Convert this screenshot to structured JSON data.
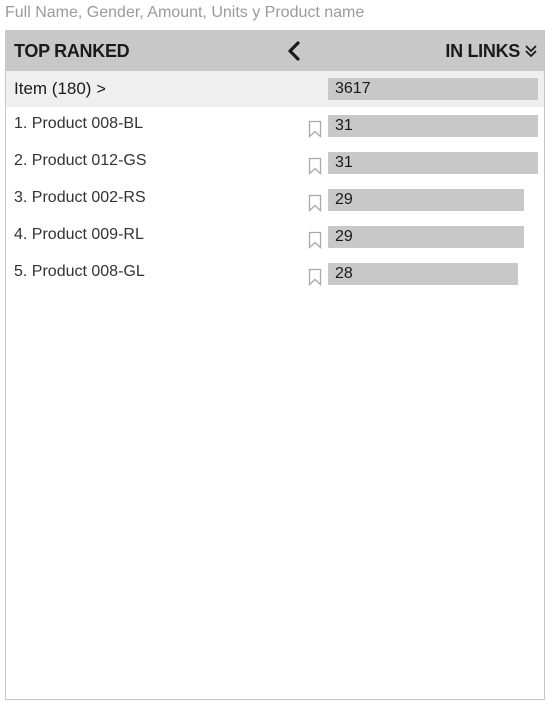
{
  "subtitle": "Full Name, Gender, Amount, Units y Product name",
  "header": {
    "title": "TOP RANKED",
    "back_icon": "chevron-left-icon",
    "sort_label": "IN LINKS",
    "sort_icon": "double-chevron-down-icon"
  },
  "summary": {
    "label": "Item (180)",
    "value": "3617",
    "chevron": ">"
  },
  "rows": [
    {
      "label": "1. Product 008-BL",
      "value": "31",
      "fraction": 1.0
    },
    {
      "label": "2. Product 012-GS",
      "value": "31",
      "fraction": 1.0
    },
    {
      "label": "3. Product 002-RS",
      "value": "29",
      "fraction": 0.935
    },
    {
      "label": "4. Product 009-RL",
      "value": "29",
      "fraction": 0.935
    },
    {
      "label": "5. Product 008-GL",
      "value": "28",
      "fraction": 0.903
    }
  ],
  "colors": {
    "header_bg": "#c8c8c8",
    "bar": "#c8c8c8",
    "summary_bg": "#efefef"
  }
}
